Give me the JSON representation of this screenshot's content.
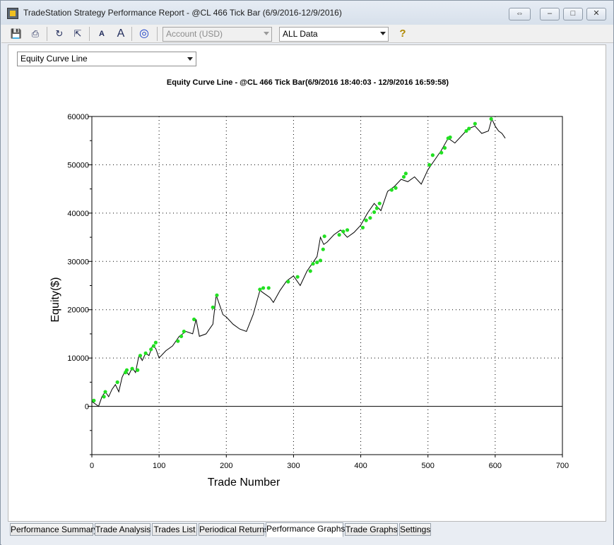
{
  "window": {
    "title": "TradeStation Strategy Performance Report - @CL 466 Tick Bar (6/9/2016-12/9/2016)",
    "caption_buttons": {
      "restore": "⇔",
      "minimize": "–",
      "maximize": "□",
      "close": "✕"
    }
  },
  "toolbar": {
    "buttons": [
      {
        "name": "save-icon",
        "glyph": "💾"
      },
      {
        "name": "print-icon",
        "glyph": "⎙"
      },
      {
        "name": "refresh-icon",
        "glyph": "↻"
      },
      {
        "name": "export-icon",
        "glyph": "⇱"
      },
      {
        "name": "decrease-font-icon",
        "glyph": "A"
      },
      {
        "name": "increase-font-icon",
        "glyph": "A"
      },
      {
        "name": "target-icon",
        "glyph": "◎"
      },
      {
        "name": "help-icon",
        "glyph": "?"
      }
    ],
    "account_select": {
      "value": "Account (USD)"
    },
    "data_select": {
      "value": "ALL Data"
    }
  },
  "graph_selector": {
    "value": "Equity Curve Line"
  },
  "chart_data": {
    "type": "line",
    "title": "Equity Curve Line - @CL 466 Tick Bar(6/9/2016 18:40:03 - 12/9/2016 16:59:58)",
    "xlabel": "Trade Number",
    "ylabel": "Equity($)",
    "xlim": [
      0,
      700
    ],
    "ylim": [
      -10000,
      60000
    ],
    "x_ticks": [
      0,
      100,
      200,
      300,
      400,
      500,
      600,
      700
    ],
    "y_ticks": [
      0,
      10000,
      20000,
      30000,
      40000,
      50000,
      60000
    ],
    "grid": true,
    "line_color": "#000000",
    "marker_color": "#22e022",
    "series": [
      {
        "x": [
          0,
          5,
          10,
          15,
          20,
          25,
          30,
          35,
          40,
          45,
          50,
          55,
          60,
          65,
          70,
          75,
          80,
          85,
          90,
          95,
          100,
          110,
          120,
          130,
          140,
          150,
          155,
          160,
          170,
          180,
          185,
          190,
          195,
          200,
          210,
          220,
          230,
          240,
          250,
          255,
          260,
          265,
          270,
          280,
          290,
          300,
          310,
          320,
          330,
          335,
          340,
          345,
          350,
          360,
          370,
          380,
          390,
          400,
          410,
          420,
          430,
          440,
          445,
          450,
          460,
          470,
          480,
          490,
          500,
          510,
          520,
          530,
          540,
          550,
          560,
          570,
          580,
          590,
          595,
          600,
          605,
          610,
          615
        ],
        "y": [
          1000,
          500,
          0,
          2000,
          3000,
          2000,
          3500,
          4500,
          3000,
          6000,
          7500,
          6500,
          8000,
          7000,
          10500,
          9500,
          11000,
          10500,
          12500,
          12000,
          10000,
          11500,
          12500,
          14500,
          15500,
          15000,
          18000,
          14500,
          15000,
          17000,
          23000,
          21000,
          19000,
          18500,
          17000,
          16000,
          15500,
          19000,
          24000,
          23500,
          23000,
          22500,
          21500,
          24000,
          26000,
          27000,
          25000,
          28000,
          30000,
          31000,
          35000,
          33500,
          34000,
          35500,
          36500,
          35000,
          36000,
          37500,
          40000,
          42000,
          40500,
          44500,
          45000,
          45500,
          47000,
          46500,
          47500,
          46000,
          49000,
          51000,
          53000,
          55500,
          54500,
          56000,
          57500,
          58000,
          56500,
          57000,
          59500,
          58000,
          57000,
          56500,
          55500
        ]
      }
    ],
    "markers": {
      "x": [
        3,
        18,
        20,
        38,
        50,
        52,
        60,
        68,
        72,
        80,
        88,
        92,
        95,
        128,
        133,
        137,
        152,
        180,
        186,
        250,
        255,
        263,
        292,
        306,
        325,
        329,
        335,
        340,
        344,
        346,
        368,
        374,
        380,
        403,
        408,
        414,
        420,
        424,
        428,
        446,
        452,
        464,
        467,
        502,
        507,
        520,
        525,
        530,
        533,
        557,
        561,
        570,
        594
      ],
      "y": [
        1200,
        2000,
        3000,
        5000,
        7000,
        7500,
        7800,
        7500,
        10500,
        11000,
        11800,
        12500,
        13200,
        13500,
        14500,
        15500,
        18000,
        20500,
        23000,
        24200,
        24500,
        24500,
        25800,
        26800,
        28000,
        29500,
        29800,
        30200,
        32500,
        35200,
        35500,
        36200,
        36500,
        37000,
        38500,
        39000,
        40200,
        41000,
        42000,
        44800,
        45200,
        47500,
        48200,
        50000,
        52000,
        52500,
        53500,
        55500,
        55700,
        57000,
        57500,
        58500,
        59500
      ]
    }
  },
  "tabs": [
    {
      "label": "Performance Summary",
      "active": false
    },
    {
      "label": "Trade Analysis",
      "active": false
    },
    {
      "label": "Trades List",
      "active": false
    },
    {
      "label": "Periodical Returns",
      "active": false
    },
    {
      "label": "Performance Graphs",
      "active": true
    },
    {
      "label": "Trade Graphs",
      "active": false
    },
    {
      "label": "Settings",
      "active": false
    }
  ]
}
